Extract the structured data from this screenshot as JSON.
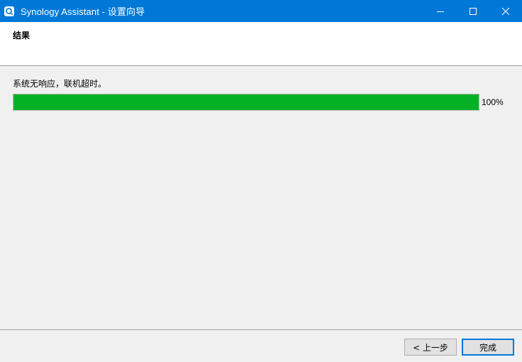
{
  "window": {
    "title": "Synology Assistant  - 设置向导",
    "icon": "synology-assistant-icon"
  },
  "header": {
    "title": "结果"
  },
  "status": {
    "message": "系统无响应，联机超时。"
  },
  "progress": {
    "value": 100,
    "label": "100%",
    "fill_color": "#06b025"
  },
  "buttons": {
    "back_label": "< 上一步",
    "finish_label": "完成"
  },
  "colors": {
    "titlebar": "#0078d7",
    "accent": "#0078d7"
  }
}
